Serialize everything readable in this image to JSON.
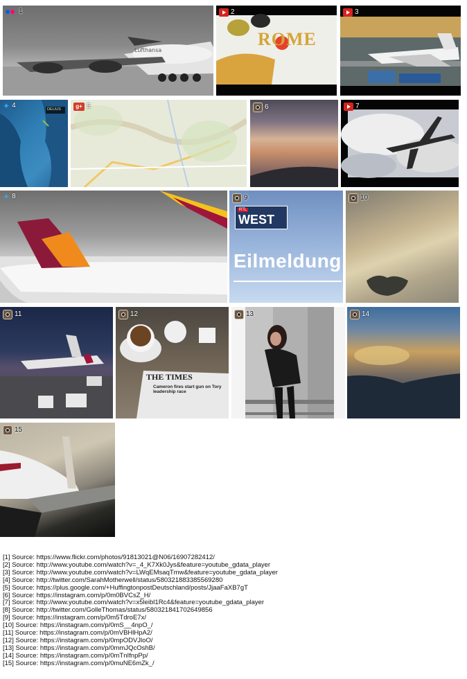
{
  "tiles": [
    {
      "num": "1",
      "source": "flickr"
    },
    {
      "num": "2",
      "source": "youtube",
      "overlay_text": "ROME"
    },
    {
      "num": "3",
      "source": "youtube"
    },
    {
      "num": "4",
      "source": "twitter",
      "map_label": "DELIUS"
    },
    {
      "num": "5",
      "source": "google-plus"
    },
    {
      "num": "6",
      "source": "instagram"
    },
    {
      "num": "7",
      "source": "youtube"
    },
    {
      "num": "8",
      "source": "twitter"
    },
    {
      "num": "9",
      "source": "instagram",
      "logo_top": "RTL",
      "logo_main": "WEST",
      "headline": "Eilmeldung"
    },
    {
      "num": "10",
      "source": "instagram"
    },
    {
      "num": "11",
      "source": "instagram"
    },
    {
      "num": "12",
      "source": "instagram",
      "newspaper_head": "THE TIMES",
      "newspaper_text": "Cameron fires start gun on Tory leadership race"
    },
    {
      "num": "13",
      "source": "instagram"
    },
    {
      "num": "14",
      "source": "instagram"
    },
    {
      "num": "15",
      "source": "instagram"
    }
  ],
  "sources": [
    "[1] Source: https://www.flickr.com/photos/91813021@N06/16907282412/",
    "[2] Source: http://www.youtube.com/watch?v=_4_K7Xk0Jys&feature=youtube_gdata_player",
    "[3] Source: http://www.youtube.com/watch?v=LWqEMsaqTmw&feature=youtube_gdata_player",
    "[4] Source: http://twitter.com/SarahMotherwell/status/580321883385569280",
    "[5] Source: https://plus.google.com/+HuffingtonpostDeutschland/posts/JjaaFaXB7gT",
    "[6] Source: https://instagram.com/p/0m0BVCsZ_H/",
    "[7] Source: http://www.youtube.com/watch?v=x5leibl1Rc4&feature=youtube_gdata_player",
    "[8] Source: http://twitter.com/GolleThomas/status/580321841702649856",
    "[9] Source: https://instagram.com/p/0m5TdroE7x/",
    "[10] Source: https://instagram.com/p/0mS__4npO_/",
    "[11] Source: https://instagram.com/p/0mVBHlHpA2/",
    "[12] Source: https://instagram.com/p/0mpODVJloO/",
    "[13] Source: https://instagram.com/p/0mmJQcOshB/",
    "[14] Source: https://instagram.com/p/0mTnIfnpPp/",
    "[15] Source: https://instagram.com/p/0muNE6mZk_/"
  ]
}
